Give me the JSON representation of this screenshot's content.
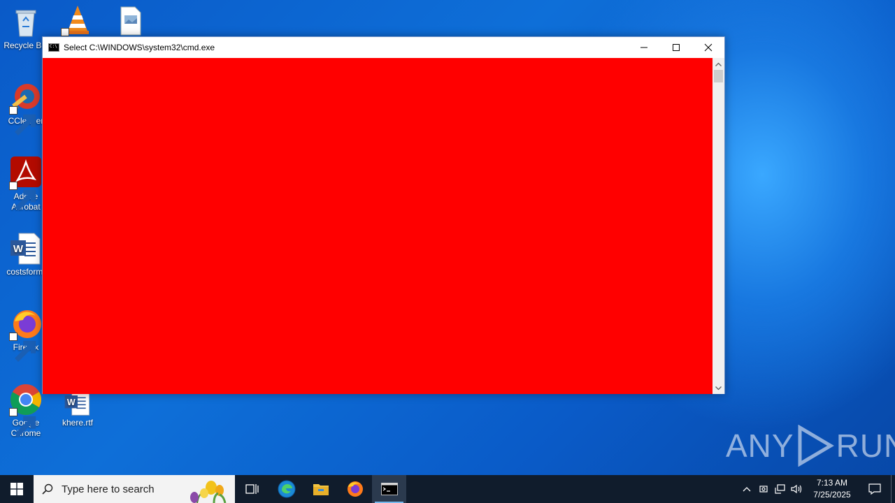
{
  "desktop": {
    "icons": [
      {
        "label": "Recycle Bin",
        "icon": "recycle-bin-icon"
      },
      {
        "label": "",
        "icon": "vlc-icon"
      },
      {
        "label": "",
        "icon": "image-file-icon"
      },
      {
        "label": "CCleaner",
        "icon": "ccleaner-icon"
      },
      {
        "label": "Adobe Acrobat",
        "icon": "adobe-acrobat-icon"
      },
      {
        "label": "costsform.",
        "icon": "word-document-icon"
      },
      {
        "label": "Firefox",
        "icon": "firefox-icon"
      },
      {
        "label": "Google Chrome",
        "icon": "chrome-icon"
      },
      {
        "label": "khere.rtf",
        "icon": "word-document-icon"
      }
    ]
  },
  "window": {
    "title": "Select C:\\WINDOWS\\system32\\cmd.exe",
    "console_bg": "#ff0000"
  },
  "watermark": {
    "left": "ANY",
    "right": "RUN"
  },
  "taskbar": {
    "search_placeholder": "Type here to search",
    "apps": [
      "task-view-icon",
      "edge-icon",
      "file-explorer-icon",
      "firefox-icon",
      "cmd-icon"
    ],
    "clock": {
      "time": "7:13 AM",
      "date": "7/25/2025"
    }
  }
}
